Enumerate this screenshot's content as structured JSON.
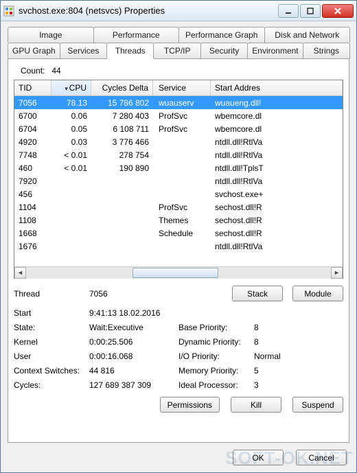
{
  "window": {
    "title": "svchost.exe:804 (netsvcs) Properties"
  },
  "tabs_row1": [
    {
      "label": "Image"
    },
    {
      "label": "Performance"
    },
    {
      "label": "Performance Graph"
    },
    {
      "label": "Disk and Network"
    }
  ],
  "tabs_row2": [
    {
      "label": "GPU Graph"
    },
    {
      "label": "Services"
    },
    {
      "label": "Threads",
      "active": true
    },
    {
      "label": "TCP/IP"
    },
    {
      "label": "Security"
    },
    {
      "label": "Environment"
    },
    {
      "label": "Strings"
    }
  ],
  "count": {
    "label": "Count:",
    "value": "44"
  },
  "columns": {
    "tid": "TID",
    "cpu": "CPU",
    "cycles": "Cycles Delta",
    "service": "Service",
    "start": "Start Addres"
  },
  "rows": [
    {
      "tid": "7056",
      "cpu": "78.13",
      "cyc": "15 786 802",
      "svc": "wuauserv",
      "sa": "wuaueng.dll!",
      "sel": true
    },
    {
      "tid": "6700",
      "cpu": "0.06",
      "cyc": "7 280 403",
      "svc": "ProfSvc",
      "sa": "wbemcore.dl"
    },
    {
      "tid": "6704",
      "cpu": "0.05",
      "cyc": "6 108 711",
      "svc": "ProfSvc",
      "sa": "wbemcore.dl"
    },
    {
      "tid": "4920",
      "cpu": "0.03",
      "cyc": "3 776 466",
      "svc": "",
      "sa": "ntdll.dll!RtlVa"
    },
    {
      "tid": "7748",
      "cpu": "< 0.01",
      "cyc": "278 754",
      "svc": "",
      "sa": "ntdll.dll!RtlVa"
    },
    {
      "tid": "460",
      "cpu": "< 0.01",
      "cyc": "190 890",
      "svc": "",
      "sa": "ntdll.dll!TplsT"
    },
    {
      "tid": "7920",
      "cpu": "",
      "cyc": "",
      "svc": "",
      "sa": "ntdll.dll!RtlVa"
    },
    {
      "tid": "456",
      "cpu": "",
      "cyc": "",
      "svc": "",
      "sa": "svchost.exe+"
    },
    {
      "tid": "1104",
      "cpu": "",
      "cyc": "",
      "svc": "ProfSvc",
      "sa": "sechost.dll!R"
    },
    {
      "tid": "1108",
      "cpu": "",
      "cyc": "",
      "svc": "Themes",
      "sa": "sechost.dll!R"
    },
    {
      "tid": "1668",
      "cpu": "",
      "cyc": "",
      "svc": "Schedule",
      "sa": "sechost.dll!R"
    },
    {
      "tid": "1676",
      "cpu": "",
      "cyc": "",
      "svc": "",
      "sa": "ntdll.dll!RtlVa"
    }
  ],
  "detail": {
    "thread_lbl": "Thread",
    "thread_val": "7056",
    "start_lbl": "Start",
    "start_val": "9:41:13   18.02.2016",
    "state_lbl": "State:",
    "state_val": "Wait:Executive",
    "kernel_lbl": "Kernel",
    "kernel_val": "0:00:25.506",
    "user_lbl": "User",
    "user_val": "0:00:16.068",
    "cs_lbl": "Context Switches:",
    "cs_val": "44 816",
    "cycles_lbl": "Cycles:",
    "cycles_val": "127 689 387 309",
    "bp_lbl": "Base Priority:",
    "bp_val": "8",
    "dp_lbl": "Dynamic Priority:",
    "dp_val": "8",
    "io_lbl": "I/O Priority:",
    "io_val": "Normal",
    "mp_lbl": "Memory Priority:",
    "mp_val": "5",
    "ip_lbl": "Ideal Processor:",
    "ip_val": "3"
  },
  "buttons": {
    "stack": "Stack",
    "module": "Module",
    "permissions": "Permissions",
    "kill": "Kill",
    "suspend": "Suspend",
    "ok": "OK",
    "cancel": "Cancel"
  },
  "watermark": "SOFT-OK.NET"
}
